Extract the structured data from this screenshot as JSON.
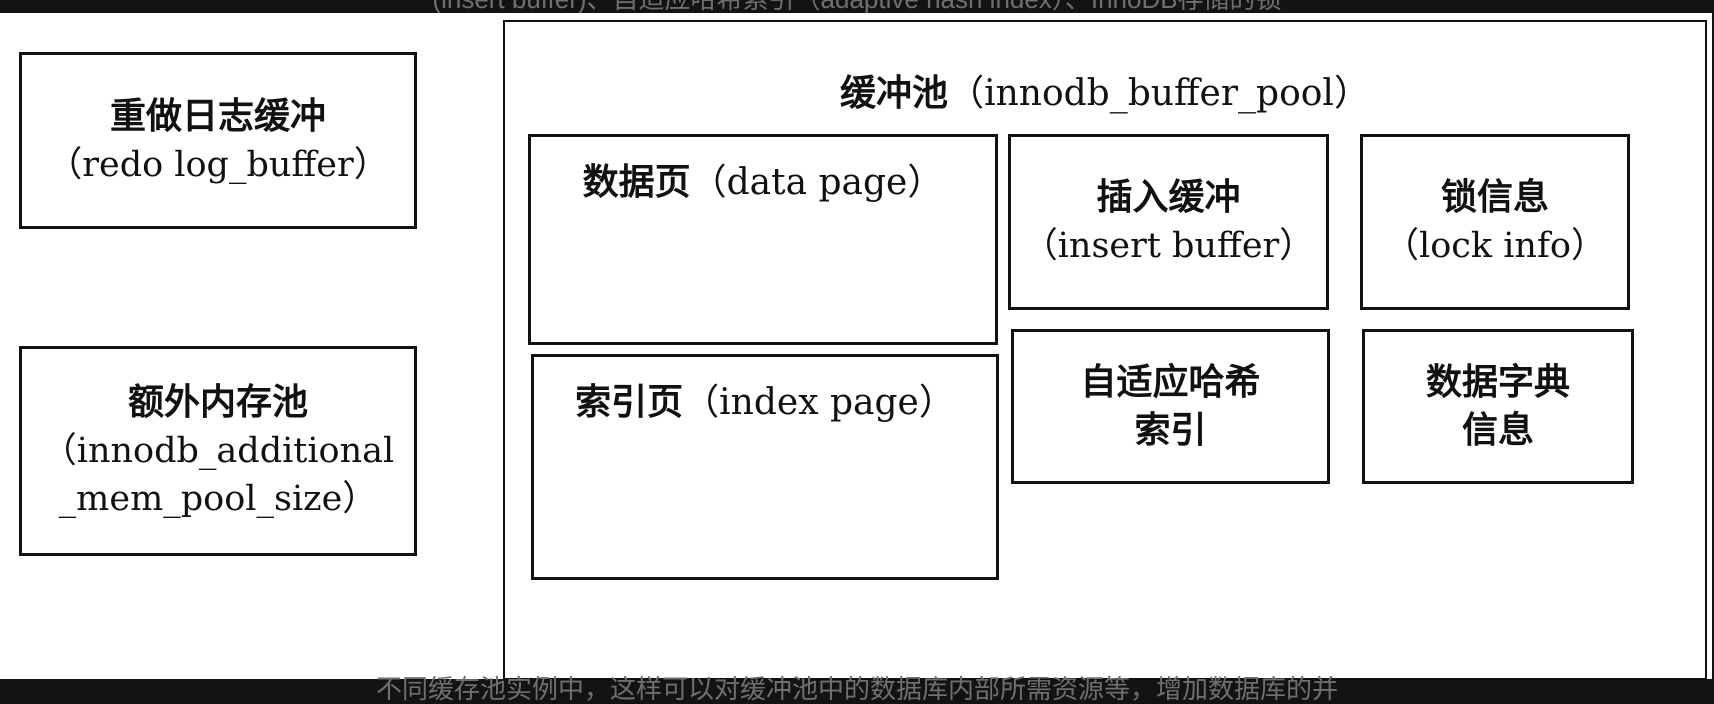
{
  "overflow": {
    "top": "(insert buffer)、自适应哈希索引（adaptive hash index）、InnoDB存储的锁",
    "bottom": "不同缓存池实例中，这样可以对缓冲池中的数据库内部所需资源等，增加数据库的并"
  },
  "redo_log_buffer": {
    "title": "重做日志缓冲",
    "subtitle": "（redo log_buffer）"
  },
  "additional_mem_pool": {
    "title": "额外内存池",
    "subtitle_line1": "（innodb_additional",
    "subtitle_line2": "_mem_pool_size）"
  },
  "buffer_pool": {
    "title_cn": "缓冲池",
    "title_en": "（innodb_buffer_pool）",
    "data_page": {
      "cn": "数据页",
      "en": "（data page）"
    },
    "index_page": {
      "cn": "索引页",
      "en": "（index page）"
    },
    "insert_buffer": {
      "title": "插入缓冲",
      "subtitle": "（insert buffer）"
    },
    "lock_info": {
      "title": "锁信息",
      "subtitle": "（lock info）"
    },
    "adaptive_hash_index": {
      "line1": "自适应哈希",
      "line2": "索引"
    },
    "data_dictionary": {
      "line1": "数据字典",
      "line2": "信息"
    }
  }
}
